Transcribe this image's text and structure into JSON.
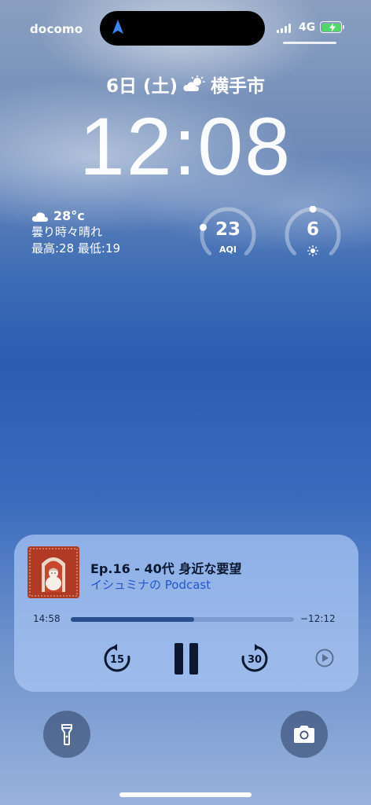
{
  "status_bar": {
    "carrier": "docomo",
    "network": "4G",
    "signal_bars": 4,
    "battery_charging": true,
    "location_icon": "navigation-arrow-icon"
  },
  "lock_screen": {
    "date": "6日 (土)",
    "weather_icon": "partly-cloudy-icon",
    "city": "横手市",
    "time": "12:08"
  },
  "weather_widget": {
    "icon": "cloud-icon",
    "temperature": "28°c",
    "condition": "曇り時々晴れ",
    "high_low": "最高:28 最低:19"
  },
  "aqi_widget": {
    "value": "23",
    "label": "AQI",
    "level": 0.23
  },
  "uv_widget": {
    "value": "6",
    "icon": "sun-icon",
    "level": 0.5
  },
  "now_playing": {
    "title": "Ep.16 - 40代 身近な要望",
    "artist": "イシュミナの Podcast",
    "elapsed": "14:58",
    "remaining": "−12:12",
    "progress": 0.552,
    "skip_back_label": "15",
    "skip_forward_label": "30",
    "colors": {
      "artist": "#2457c8",
      "progress_fill": "#2a4f8f"
    }
  },
  "quick_actions": {
    "left": "flashlight-icon",
    "right": "camera-icon"
  }
}
